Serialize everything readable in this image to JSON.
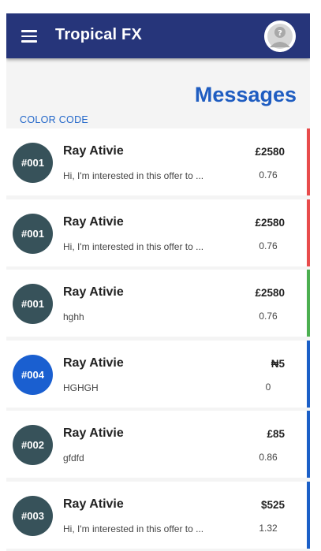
{
  "app": {
    "title": "Tropical FX",
    "menu_icon": "hamburger-menu-icon",
    "avatar_icon": "user-placeholder-icon"
  },
  "page": {
    "title": "Messages",
    "color_code_label": "COLOR CODE"
  },
  "colors": {
    "appbar": "#26357a",
    "accent_blue": "#1f5dc1",
    "red": "#e84c4c",
    "green": "#4caf50",
    "blue": "#1b5fc7",
    "badge_dark": "#37525a",
    "badge_blue": "#1a5fd0"
  },
  "messages": [
    {
      "code": "#001",
      "name": "Ray Ativie",
      "preview": "Hi, I'm interested in this offer to ...",
      "amount": "£2580",
      "rate": "0.76",
      "status_color": "#e84c4c",
      "badge_color": "#37525a"
    },
    {
      "code": "#001",
      "name": "Ray Ativie",
      "preview": "Hi, I'm interested in this offer to ...",
      "amount": "£2580",
      "rate": "0.76",
      "status_color": "#e84c4c",
      "badge_color": "#37525a"
    },
    {
      "code": "#001",
      "name": "Ray Ativie",
      "preview": "hghh",
      "amount": "£2580",
      "rate": "0.76",
      "status_color": "#4caf50",
      "badge_color": "#37525a"
    },
    {
      "code": "#004",
      "name": "Ray Ativie",
      "preview": "HGHGH",
      "amount": "₦5",
      "rate": "0",
      "status_color": "#1b5fc7",
      "badge_color": "#1a5fd0"
    },
    {
      "code": "#002",
      "name": "Ray Ativie",
      "preview": "gfdfd",
      "amount": "£85",
      "rate": "0.86",
      "status_color": "#1b5fc7",
      "badge_color": "#37525a"
    },
    {
      "code": "#003",
      "name": "Ray Ativie",
      "preview": "Hi, I'm interested in this offer to ...",
      "amount": "$525",
      "rate": "1.32",
      "status_color": "#1b5fc7",
      "badge_color": "#37525a"
    }
  ]
}
